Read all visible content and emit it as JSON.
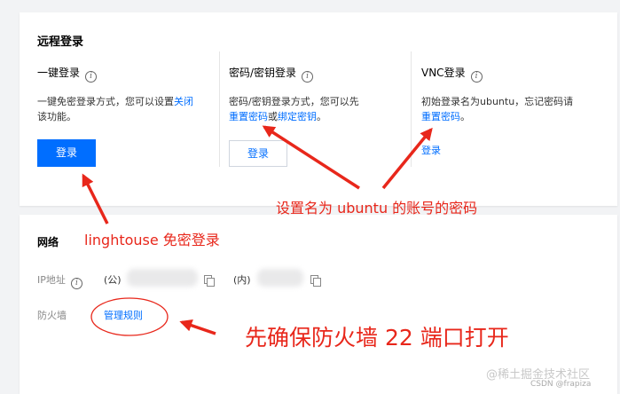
{
  "remote_login": {
    "title": "远程登录",
    "one_click": {
      "title": "一键登录",
      "desc_line1_prefix": "一键免密登录方式，您可以设置",
      "desc_line1_link": "关闭",
      "desc_line2": "该功能。",
      "button": "登录"
    },
    "password": {
      "title": "密码/密钥登录",
      "desc_line1": "密码/密钥登录方式，您可以先",
      "link_reset": "重置密码",
      "desc_or": "或",
      "link_bind": "绑定密钥",
      "desc_end": "。",
      "button": "登录"
    },
    "vnc": {
      "title": "VNC登录",
      "desc_line1": "初始登录名为ubuntu，忘记密码请",
      "link_reset": "重置密码",
      "desc_end": "。",
      "button": "登录"
    }
  },
  "network": {
    "title": "网络",
    "ip_label": "IP地址",
    "public_prefix": "(公)",
    "private_prefix": "(内)",
    "firewall_label": "防火墙",
    "manage_rules": "管理规则"
  },
  "annotations": {
    "set_password": "设置名为 ubuntu 的账号的密码",
    "lighthouse": "linghtouse 免密登录",
    "firewall": "先确保防火墙 22 端口打开"
  },
  "watermark": {
    "site": "@稀土掘金技术社区",
    "csdn": "CSDN @frapiza"
  },
  "colors": {
    "primary": "#006eff",
    "annotation": "#e8271b"
  },
  "icons": [
    "info-icon",
    "copy-icon",
    "arrow-annotation"
  ]
}
